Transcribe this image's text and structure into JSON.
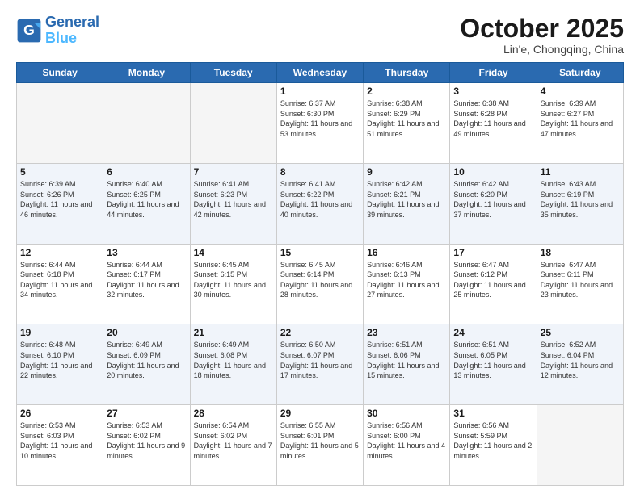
{
  "header": {
    "logo_line1": "General",
    "logo_line2": "Blue",
    "month": "October 2025",
    "location": "Lin'e, Chongqing, China"
  },
  "weekdays": [
    "Sunday",
    "Monday",
    "Tuesday",
    "Wednesday",
    "Thursday",
    "Friday",
    "Saturday"
  ],
  "weeks": [
    [
      {
        "day": "",
        "info": ""
      },
      {
        "day": "",
        "info": ""
      },
      {
        "day": "",
        "info": ""
      },
      {
        "day": "1",
        "info": "Sunrise: 6:37 AM\nSunset: 6:30 PM\nDaylight: 11 hours and 53 minutes."
      },
      {
        "day": "2",
        "info": "Sunrise: 6:38 AM\nSunset: 6:29 PM\nDaylight: 11 hours and 51 minutes."
      },
      {
        "day": "3",
        "info": "Sunrise: 6:38 AM\nSunset: 6:28 PM\nDaylight: 11 hours and 49 minutes."
      },
      {
        "day": "4",
        "info": "Sunrise: 6:39 AM\nSunset: 6:27 PM\nDaylight: 11 hours and 47 minutes."
      }
    ],
    [
      {
        "day": "5",
        "info": "Sunrise: 6:39 AM\nSunset: 6:26 PM\nDaylight: 11 hours and 46 minutes."
      },
      {
        "day": "6",
        "info": "Sunrise: 6:40 AM\nSunset: 6:25 PM\nDaylight: 11 hours and 44 minutes."
      },
      {
        "day": "7",
        "info": "Sunrise: 6:41 AM\nSunset: 6:23 PM\nDaylight: 11 hours and 42 minutes."
      },
      {
        "day": "8",
        "info": "Sunrise: 6:41 AM\nSunset: 6:22 PM\nDaylight: 11 hours and 40 minutes."
      },
      {
        "day": "9",
        "info": "Sunrise: 6:42 AM\nSunset: 6:21 PM\nDaylight: 11 hours and 39 minutes."
      },
      {
        "day": "10",
        "info": "Sunrise: 6:42 AM\nSunset: 6:20 PM\nDaylight: 11 hours and 37 minutes."
      },
      {
        "day": "11",
        "info": "Sunrise: 6:43 AM\nSunset: 6:19 PM\nDaylight: 11 hours and 35 minutes."
      }
    ],
    [
      {
        "day": "12",
        "info": "Sunrise: 6:44 AM\nSunset: 6:18 PM\nDaylight: 11 hours and 34 minutes."
      },
      {
        "day": "13",
        "info": "Sunrise: 6:44 AM\nSunset: 6:17 PM\nDaylight: 11 hours and 32 minutes."
      },
      {
        "day": "14",
        "info": "Sunrise: 6:45 AM\nSunset: 6:15 PM\nDaylight: 11 hours and 30 minutes."
      },
      {
        "day": "15",
        "info": "Sunrise: 6:45 AM\nSunset: 6:14 PM\nDaylight: 11 hours and 28 minutes."
      },
      {
        "day": "16",
        "info": "Sunrise: 6:46 AM\nSunset: 6:13 PM\nDaylight: 11 hours and 27 minutes."
      },
      {
        "day": "17",
        "info": "Sunrise: 6:47 AM\nSunset: 6:12 PM\nDaylight: 11 hours and 25 minutes."
      },
      {
        "day": "18",
        "info": "Sunrise: 6:47 AM\nSunset: 6:11 PM\nDaylight: 11 hours and 23 minutes."
      }
    ],
    [
      {
        "day": "19",
        "info": "Sunrise: 6:48 AM\nSunset: 6:10 PM\nDaylight: 11 hours and 22 minutes."
      },
      {
        "day": "20",
        "info": "Sunrise: 6:49 AM\nSunset: 6:09 PM\nDaylight: 11 hours and 20 minutes."
      },
      {
        "day": "21",
        "info": "Sunrise: 6:49 AM\nSunset: 6:08 PM\nDaylight: 11 hours and 18 minutes."
      },
      {
        "day": "22",
        "info": "Sunrise: 6:50 AM\nSunset: 6:07 PM\nDaylight: 11 hours and 17 minutes."
      },
      {
        "day": "23",
        "info": "Sunrise: 6:51 AM\nSunset: 6:06 PM\nDaylight: 11 hours and 15 minutes."
      },
      {
        "day": "24",
        "info": "Sunrise: 6:51 AM\nSunset: 6:05 PM\nDaylight: 11 hours and 13 minutes."
      },
      {
        "day": "25",
        "info": "Sunrise: 6:52 AM\nSunset: 6:04 PM\nDaylight: 11 hours and 12 minutes."
      }
    ],
    [
      {
        "day": "26",
        "info": "Sunrise: 6:53 AM\nSunset: 6:03 PM\nDaylight: 11 hours and 10 minutes."
      },
      {
        "day": "27",
        "info": "Sunrise: 6:53 AM\nSunset: 6:02 PM\nDaylight: 11 hours and 9 minutes."
      },
      {
        "day": "28",
        "info": "Sunrise: 6:54 AM\nSunset: 6:02 PM\nDaylight: 11 hours and 7 minutes."
      },
      {
        "day": "29",
        "info": "Sunrise: 6:55 AM\nSunset: 6:01 PM\nDaylight: 11 hours and 5 minutes."
      },
      {
        "day": "30",
        "info": "Sunrise: 6:56 AM\nSunset: 6:00 PM\nDaylight: 11 hours and 4 minutes."
      },
      {
        "day": "31",
        "info": "Sunrise: 6:56 AM\nSunset: 5:59 PM\nDaylight: 11 hours and 2 minutes."
      },
      {
        "day": "",
        "info": ""
      }
    ]
  ]
}
